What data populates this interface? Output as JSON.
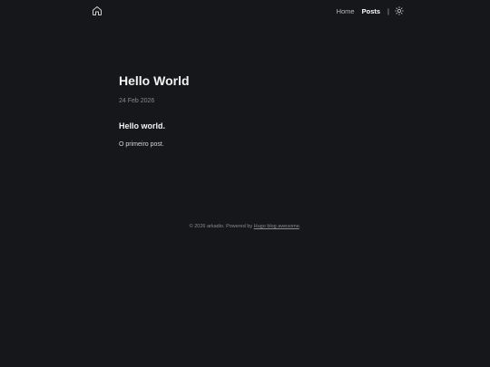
{
  "nav": {
    "home_icon": "home-icon",
    "links": [
      {
        "label": "Home"
      },
      {
        "label": "Posts"
      }
    ],
    "separator": "|",
    "theme_icon": "sun-icon"
  },
  "post": {
    "title": "Hello World",
    "date": "24 Feb 2026",
    "heading": "Hello world.",
    "paragraph": "O primeiro post."
  },
  "footer": {
    "prefix": "© 2026 arkadio.  Powered by ",
    "link_label": "Hugo blog awesome",
    "suffix": "."
  },
  "colors": {
    "background": "#16171b",
    "text": "#e6e6e6",
    "muted": "#8a8a8a"
  }
}
